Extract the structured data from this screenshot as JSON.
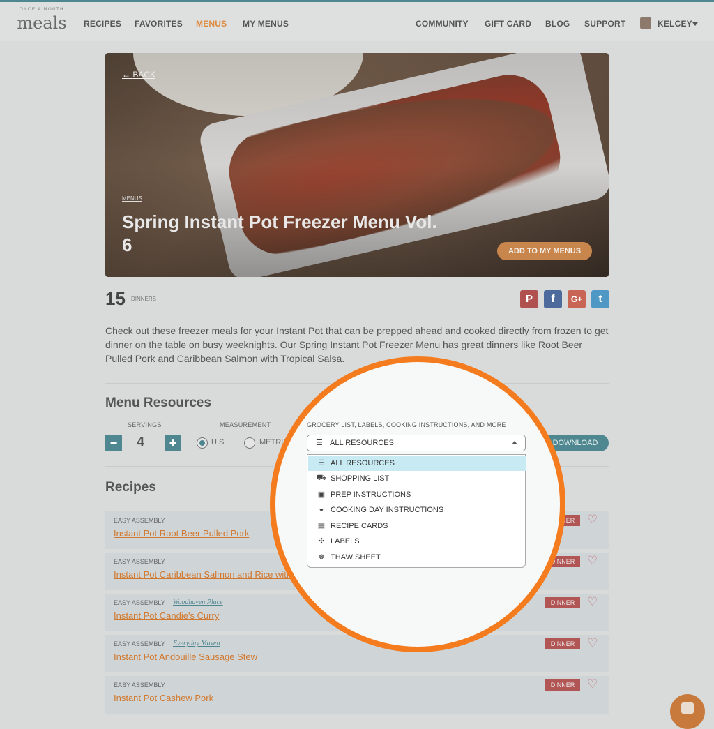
{
  "nav": {
    "logo_small": "ONCE A MONTH",
    "logo_big": "meals",
    "left_items": [
      "RECIPES",
      "FAVORITES",
      "MENUS",
      "MY MENUS"
    ],
    "right_items": [
      "COMMUNITY",
      "GIFT CARD",
      "BLOG",
      "SUPPORT"
    ],
    "user": "KELCEY",
    "active": "MENUS"
  },
  "hero": {
    "back": "BACK",
    "category": "MENUS",
    "title": "Spring Instant Pot Freezer Menu Vol. 6",
    "add_button": "ADD TO MY MENUS"
  },
  "summary": {
    "count": "15",
    "count_label": "DINNERS",
    "social": [
      "pinterest-icon",
      "facebook-icon",
      "google-plus-icon",
      "twitter-icon"
    ],
    "social_colors": [
      "#b0504f",
      "#4c6a9c",
      "#c96555",
      "#4f98c5"
    ]
  },
  "description": "Check out these freezer meals for your Instant Pot that can be prepped ahead and cooked directly from frozen to get dinner on the table on busy weeknights. Our Spring Instant Pot Freezer Menu has great dinners like Root Beer Pulled Pork and Caribbean Salmon with Tropical Salsa.",
  "resources": {
    "heading": "Menu Resources",
    "servings_label": "SERVINGS",
    "servings_value": "4",
    "minus": "−",
    "plus": "+",
    "measurement_label": "MEASUREMENT",
    "options": [
      "U.S.",
      "METRIC"
    ],
    "selected_option": "U.S.",
    "dropdown_label": "GROCERY LIST, LABELS, COOKING INSTRUCTIONS, AND MORE",
    "dropdown_selected": "ALL RESOURCES",
    "dropdown_options": [
      {
        "label": "ALL RESOURCES",
        "icon": "list-icon"
      },
      {
        "label": "SHOPPING LIST",
        "icon": "cart-icon"
      },
      {
        "label": "PREP INSTRUCTIONS",
        "icon": "prep-icon"
      },
      {
        "label": "COOKING DAY INSTRUCTIONS",
        "icon": "pan-icon"
      },
      {
        "label": "RECIPE CARDS",
        "icon": "card-icon"
      },
      {
        "label": "LABELS",
        "icon": "label-icon"
      },
      {
        "label": "THAW SHEET",
        "icon": "thaw-icon"
      }
    ],
    "download": "DOWNLOAD"
  },
  "recipes": {
    "heading": "Recipes",
    "items": [
      {
        "type": "EASY ASSEMBLY",
        "author": "",
        "title": "Instant Pot Root Beer Pulled Pork",
        "badge": "DINNER"
      },
      {
        "type": "EASY ASSEMBLY",
        "author": "",
        "title": "Instant Pot Caribbean Salmon and Rice with Tropical Salsa",
        "badge": "DINNER"
      },
      {
        "type": "EASY ASSEMBLY",
        "author": "Woodhaven Place",
        "title": "Instant Pot Candie's Curry",
        "badge": "DINNER"
      },
      {
        "type": "EASY ASSEMBLY",
        "author": "Everyday Maven",
        "title": "Instant Pot Andouille Sausage Stew",
        "badge": "DINNER"
      },
      {
        "type": "EASY ASSEMBLY",
        "author": "",
        "title": "Instant Pot Cashew Pork",
        "badge": "DINNER"
      }
    ]
  },
  "colors": {
    "accent": "#f47c1f",
    "teal": "#4f8791",
    "link": "#d1782e"
  }
}
